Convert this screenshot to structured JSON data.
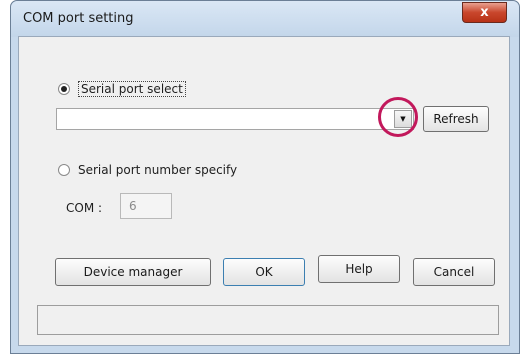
{
  "window": {
    "title": "COM port setting",
    "close_label": "x"
  },
  "serial_select": {
    "label": "Serial port select",
    "selected": true,
    "combo_value": "",
    "refresh_label": "Refresh"
  },
  "serial_number": {
    "label": "Serial port number specify",
    "selected": false,
    "com_label": "COM :",
    "com_value": "6"
  },
  "buttons": {
    "device_manager": "Device manager",
    "ok": "OK",
    "help": "Help",
    "cancel": "Cancel"
  },
  "status_text": "",
  "colors": {
    "highlight_ring": "#c2185b",
    "close_button": "#c9462c"
  }
}
